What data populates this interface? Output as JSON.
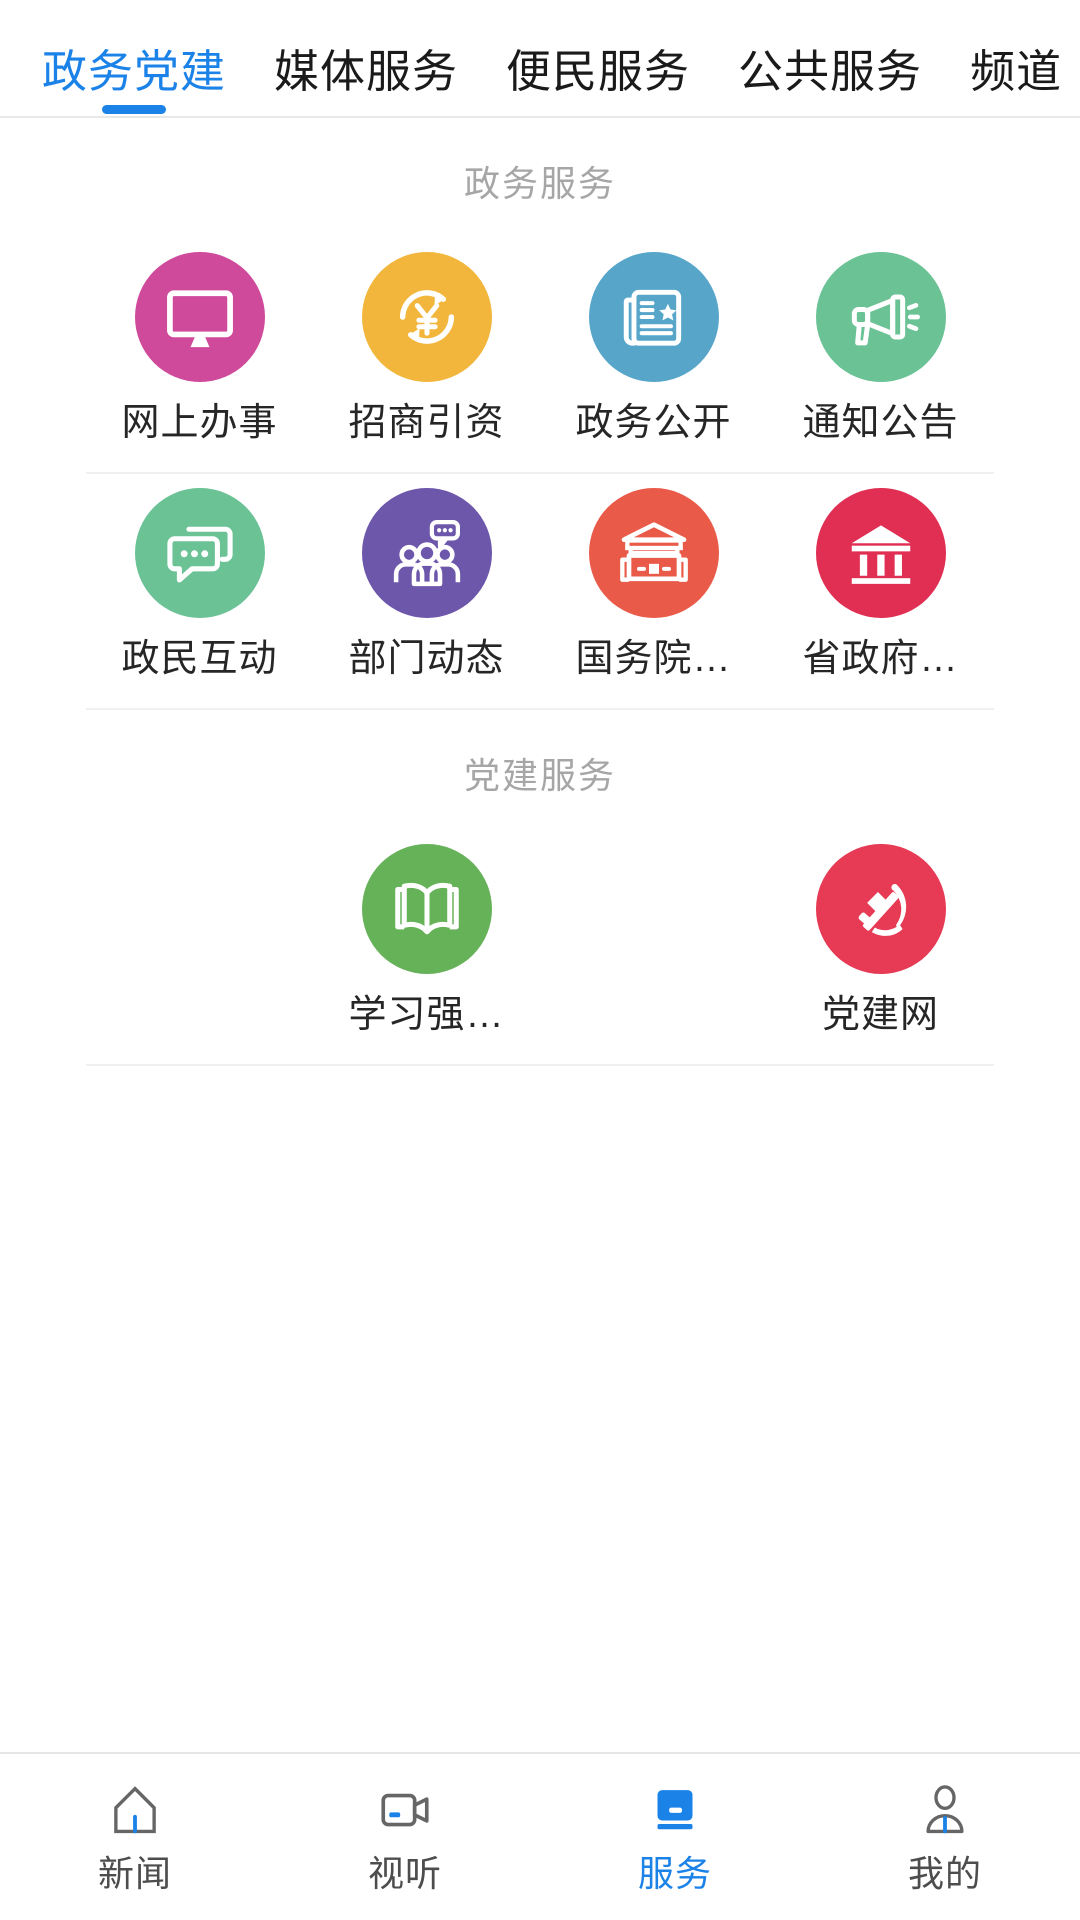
{
  "colors": {
    "accent": "#1b82e8",
    "tab_inactive_text": "#1a1a1a",
    "section_title": "#a6a6a6",
    "label_text": "#262626",
    "divider": "#f0f0f0",
    "nav_inactive": "#4d4d4d",
    "icon_pink": "#cf4a9b",
    "icon_yellow": "#f2b63c",
    "icon_blue": "#57a6ca",
    "icon_green": "#6ac295",
    "icon_green2": "#6ac295",
    "icon_purple": "#6c57ab",
    "icon_orange": "#ea5a49",
    "icon_crimson": "#e02f52",
    "icon_leafgreen": "#66b259",
    "icon_partyred": "#e63a55"
  },
  "tabs": [
    {
      "label": "政务党建",
      "active": true
    },
    {
      "label": "媒体服务",
      "active": false
    },
    {
      "label": "便民服务",
      "active": false
    },
    {
      "label": "公共服务",
      "active": false
    },
    {
      "label": "频道",
      "active": false
    }
  ],
  "sections": [
    {
      "title": "政务服务",
      "items": [
        {
          "label": "网上办事",
          "icon": "monitor-icon",
          "color": "#cf4a9b"
        },
        {
          "label": "招商引资",
          "icon": "yuan-refresh-icon",
          "color": "#f2b63c"
        },
        {
          "label": "政务公开",
          "icon": "newspaper-star-icon",
          "color": "#57a6ca"
        },
        {
          "label": "通知公告",
          "icon": "megaphone-icon",
          "color": "#6ac295"
        },
        {
          "label": "政民互动",
          "icon": "chat-bubbles-icon",
          "color": "#6ac295"
        },
        {
          "label": "部门动态",
          "icon": "people-group-icon",
          "color": "#6c57ab"
        },
        {
          "label": "国务院…",
          "icon": "chinese-gate-icon",
          "color": "#ea5a49"
        },
        {
          "label": "省政府…",
          "icon": "government-building-icon",
          "color": "#e02f52"
        }
      ]
    },
    {
      "title": "党建服务",
      "items": [
        {
          "label": "学习强…",
          "icon": "open-book-icon",
          "color": "#66b259"
        },
        {
          "label": "党建网",
          "icon": "hammer-sickle-icon",
          "color": "#e63a55"
        }
      ]
    }
  ],
  "bottom_nav": [
    {
      "label": "新闻",
      "icon": "home-icon",
      "active": false
    },
    {
      "label": "视听",
      "icon": "video-camera-icon",
      "active": false
    },
    {
      "label": "服务",
      "icon": "service-card-icon",
      "active": true
    },
    {
      "label": "我的",
      "icon": "person-icon",
      "active": false
    }
  ]
}
